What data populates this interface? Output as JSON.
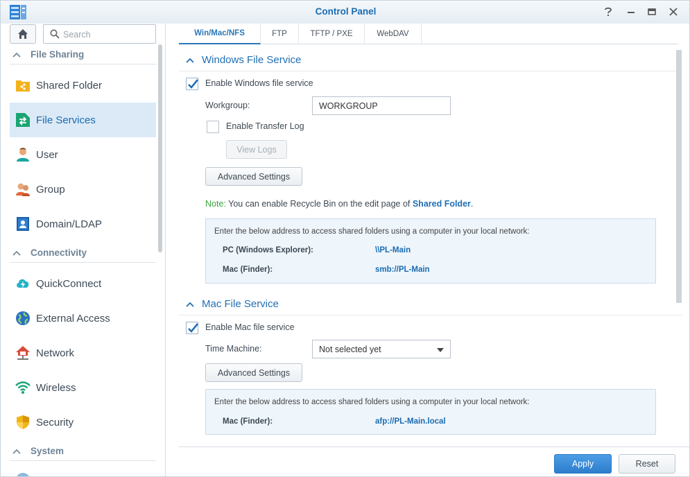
{
  "window": {
    "title": "Control Panel"
  },
  "colors": {
    "accent": "#1a6bb0",
    "selected_bg": "#dceaf7",
    "note_green": "#3aa53a"
  },
  "sidebar": {
    "search_placeholder": "Search",
    "sections": [
      {
        "label": "File Sharing",
        "items": [
          {
            "label": "Shared Folder",
            "icon": "shared-folder-icon"
          },
          {
            "label": "File Services",
            "icon": "file-services-icon",
            "selected": true
          },
          {
            "label": "User",
            "icon": "user-icon"
          },
          {
            "label": "Group",
            "icon": "group-icon"
          },
          {
            "label": "Domain/LDAP",
            "icon": "domain-ldap-icon"
          }
        ]
      },
      {
        "label": "Connectivity",
        "items": [
          {
            "label": "QuickConnect",
            "icon": "quickconnect-icon"
          },
          {
            "label": "External Access",
            "icon": "external-access-icon"
          },
          {
            "label": "Network",
            "icon": "network-icon"
          },
          {
            "label": "Wireless",
            "icon": "wireless-icon"
          },
          {
            "label": "Security",
            "icon": "security-icon"
          }
        ]
      },
      {
        "label": "System",
        "items": []
      }
    ]
  },
  "tabs": [
    {
      "label": "Win/Mac/NFS",
      "active": true
    },
    {
      "label": "FTP"
    },
    {
      "label": "TFTP / PXE"
    },
    {
      "label": "WebDAV"
    }
  ],
  "windows_service": {
    "heading": "Windows File Service",
    "enable_label": "Enable Windows file service",
    "enable_checked": true,
    "workgroup_label": "Workgroup:",
    "workgroup_value": "WORKGROUP",
    "transfer_log_label": "Enable Transfer Log",
    "transfer_log_checked": false,
    "view_logs_label": "View Logs",
    "advanced_label": "Advanced Settings",
    "note_prefix": "Note:",
    "note_text": " You can enable Recycle Bin on the edit page of ",
    "note_link": "Shared Folder",
    "note_suffix": ".",
    "info_intro": "Enter the below address to access shared folders using a computer in your local network:",
    "info_rows": [
      {
        "key": "PC (Windows Explorer):",
        "value": "\\\\PL-Main"
      },
      {
        "key": "Mac (Finder):",
        "value": "smb://PL-Main"
      }
    ]
  },
  "mac_service": {
    "heading": "Mac File Service",
    "enable_label": "Enable Mac file service",
    "enable_checked": true,
    "time_machine_label": "Time Machine:",
    "time_machine_value": "Not selected yet",
    "advanced_label": "Advanced Settings",
    "info_intro": "Enter the below address to access shared folders using a computer in your local network:",
    "info_rows": [
      {
        "key": "Mac (Finder):",
        "value": "afp://PL-Main.local"
      }
    ]
  },
  "footer": {
    "apply_label": "Apply",
    "reset_label": "Reset"
  }
}
